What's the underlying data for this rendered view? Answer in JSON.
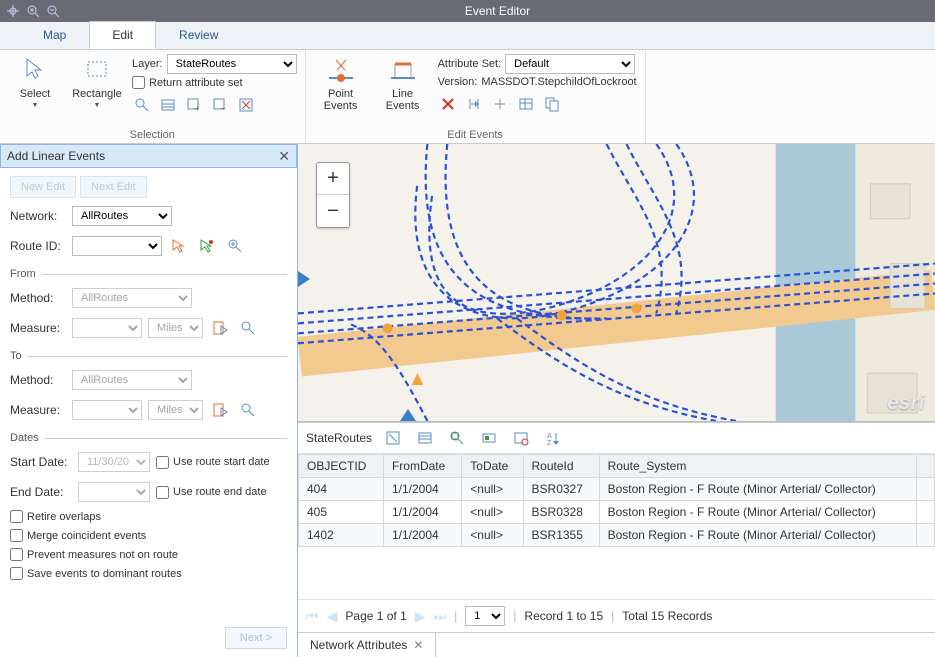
{
  "titlebar": {
    "title": "Event Editor"
  },
  "tabs": {
    "map": "Map",
    "edit": "Edit",
    "review": "Review"
  },
  "ribbon": {
    "selection": {
      "select": "Select",
      "rectangle": "Rectangle",
      "layer_label": "Layer:",
      "layer_value": "StateRoutes",
      "return_attr": "Return attribute set",
      "title": "Selection"
    },
    "events": {
      "point": "Point\nEvents",
      "line": "Line\nEvents",
      "attrset_label": "Attribute Set:",
      "attrset_value": "Default",
      "version_label": "Version:",
      "version_value": "MASSDOT.StepchildOfLockroot",
      "title": "Edit Events"
    }
  },
  "side": {
    "title": "Add Linear Events",
    "new_edit": "New Edit",
    "next_edit": "Next Edit",
    "network_label": "Network:",
    "network_value": "AllRoutes",
    "routeid_label": "Route ID:",
    "from": "From",
    "to": "To",
    "method_label": "Method:",
    "method_value": "AllRoutes",
    "measure_label": "Measure:",
    "measure_unit": "Miles",
    "dates": "Dates",
    "start_label": "Start Date:",
    "start_value": "11/30/20",
    "end_label": "End Date:",
    "use_start": "Use route start date",
    "use_end": "Use route end date",
    "retire": "Retire overlaps",
    "merge": "Merge coincident events",
    "prevent": "Prevent measures not on route",
    "dominant": "Save events to dominant routes",
    "next": "Next >"
  },
  "attr": {
    "name": "StateRoutes",
    "columns": [
      "OBJECTID",
      "FromDate",
      "ToDate",
      "RouteId",
      "Route_System"
    ],
    "rows": [
      {
        "OBJECTID": "404",
        "FromDate": "1/1/2004",
        "ToDate": "<null>",
        "RouteId": "BSR0327",
        "Route_System": "Boston Region - F Route (Minor Arterial/ Collector)"
      },
      {
        "OBJECTID": "405",
        "FromDate": "1/1/2004",
        "ToDate": "<null>",
        "RouteId": "BSR0328",
        "Route_System": "Boston Region - F Route (Minor Arterial/ Collector)"
      },
      {
        "OBJECTID": "1402",
        "FromDate": "1/1/2004",
        "ToDate": "<null>",
        "RouteId": "BSR1355",
        "Route_System": "Boston Region - F Route (Minor Arterial/ Collector)"
      }
    ]
  },
  "pager": {
    "page_text": "Page 1 of 1",
    "page_num": "1",
    "record_text": "Record 1 to 15",
    "total_text": "Total 15 Records"
  },
  "bottom_tab": "Network Attributes",
  "map": {
    "attribution": "esri"
  }
}
